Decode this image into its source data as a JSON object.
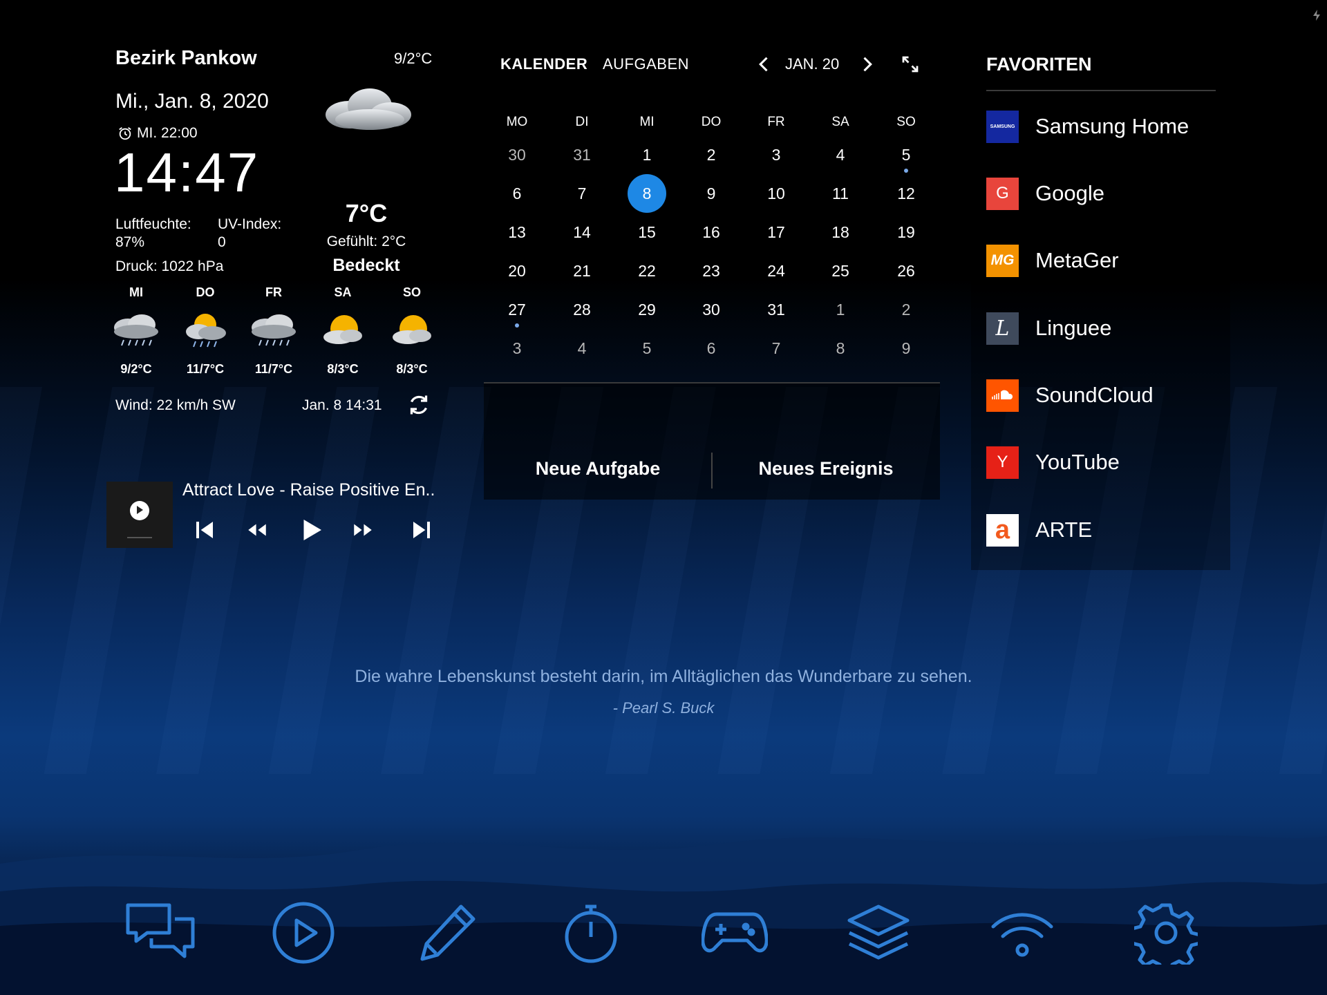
{
  "weather": {
    "location": "Bezirk Pankow",
    "minmax": "9/2°C",
    "date": "Mi., Jan. 8, 2020",
    "alarm": "MI. 22:00",
    "clock": "14:47",
    "humidity_label": "Luftfeuchte:",
    "humidity_value": "87%",
    "uv_label": "UV-Index:",
    "uv_value": "0",
    "pressure": "Druck: 1022 hPa",
    "temp": "7°C",
    "feels": "Gefühlt: 2°C",
    "condition": "Bedeckt",
    "forecast": [
      {
        "day": "MI",
        "temps": "9/2°C",
        "icon": "rain-cloud-icon"
      },
      {
        "day": "DO",
        "temps": "11/7°C",
        "icon": "sun-rain-icon"
      },
      {
        "day": "FR",
        "temps": "11/7°C",
        "icon": "rain-cloud-icon"
      },
      {
        "day": "SA",
        "temps": "8/3°C",
        "icon": "sun-cloud-icon"
      },
      {
        "day": "SO",
        "temps": "8/3°C",
        "icon": "sun-cloud-icon"
      }
    ],
    "wind": "Wind: 22 km/h SW",
    "updated": "Jan. 8  14:31"
  },
  "media": {
    "title": "Attract Love - Raise Positive En.."
  },
  "calendar": {
    "tab_calendar": "KALENDER",
    "tab_tasks": "AUFGABEN",
    "month": "JAN. 20",
    "weekdays": [
      "MO",
      "DI",
      "MI",
      "DO",
      "FR",
      "SA",
      "SO"
    ],
    "weeks": [
      [
        "30",
        "31",
        "1",
        "2",
        "3",
        "4",
        "5"
      ],
      [
        "6",
        "7",
        "8",
        "9",
        "10",
        "11",
        "12"
      ],
      [
        "13",
        "14",
        "15",
        "16",
        "17",
        "18",
        "19"
      ],
      [
        "20",
        "21",
        "22",
        "23",
        "24",
        "25",
        "26"
      ],
      [
        "27",
        "28",
        "29",
        "30",
        "31",
        "1",
        "2"
      ],
      [
        "3",
        "4",
        "5",
        "6",
        "7",
        "8",
        "9"
      ]
    ],
    "new_task": "Neue Aufgabe",
    "new_event": "Neues Ereignis"
  },
  "favorites": {
    "title": "FAVORITEN",
    "items": [
      {
        "label": "Samsung Home",
        "icon_text": "SAMSUNG",
        "color": "#1428a0"
      },
      {
        "label": "Google",
        "icon_text": "G",
        "color": "#e8453c"
      },
      {
        "label": "MetaGer",
        "icon_text": "MG",
        "color": "#f39200"
      },
      {
        "label": "Linguee",
        "icon_text": "L",
        "color": "#3f4a5c"
      },
      {
        "label": "SoundCloud",
        "icon_text": "",
        "color": "#ff5500"
      },
      {
        "label": "YouTube",
        "icon_text": "Y",
        "color": "#e62117"
      },
      {
        "label": "ARTE",
        "icon_text": "a",
        "color": "#ffffff"
      }
    ]
  },
  "quote": {
    "text": "Die wahre Lebenskunst besteht darin, im Alltäglichen das Wunderbare zu sehen.",
    "author": "- Pearl S. Buck"
  },
  "dock": [
    "chat-icon",
    "play-circle-icon",
    "pencil-icon",
    "stopwatch-icon",
    "gamepad-icon",
    "layers-icon",
    "wifi-icon",
    "gear-icon"
  ],
  "colors": {
    "accent": "#1e88e5",
    "dock_icon": "#2f7fd6",
    "quote": "#8fb1df"
  }
}
